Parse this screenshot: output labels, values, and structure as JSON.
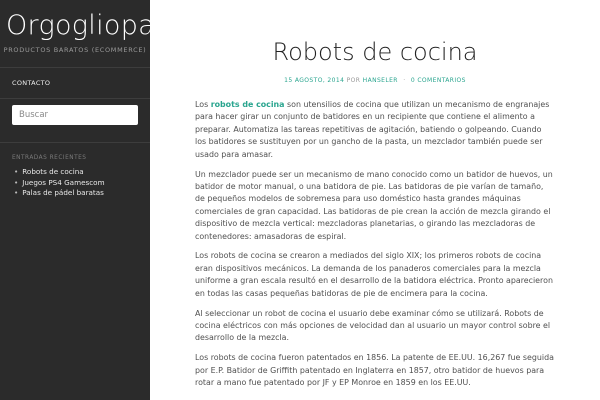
{
  "site": {
    "title": "Orgogliopa",
    "description": "PRODUCTOS BARATOS (ECOMMERCE)"
  },
  "menu": {
    "items": [
      {
        "label": "CONTACTO"
      }
    ]
  },
  "search": {
    "placeholder": "Buscar"
  },
  "recent_posts": {
    "title": "ENTRADAS RECIENTES",
    "items": [
      {
        "label": "Robots de cocina"
      },
      {
        "label": "Juegos PS4 Gamescom"
      },
      {
        "label": "Palas de pádel baratas"
      }
    ]
  },
  "post": {
    "title": "Robots de cocina",
    "meta": {
      "date": "15 AGOSTO, 2014",
      "by": "POR",
      "author": "HANSELER",
      "separator": "·",
      "comments": "0 COMENTARIOS"
    },
    "p1": {
      "before": "Los ",
      "highlight": "robots de cocina",
      "after": " son utensilios de cocina que utilizan un mecanismo de engranajes para hacer girar un conjunto de batidores en un recipiente que contiene el alimento a preparar. Automatiza las tareas repetitivas de agitación, batiendo o golpeando. Cuando los batidores se sustituyen por un gancho de la pasta, un mezclador también puede ser usado para amasar."
    },
    "p2": "Un mezclador puede ser un mecanismo de mano conocido como un batidor de huevos, un batidor de motor manual, o una batidora de pie. Las batidoras de pie varían de tamaño, de pequeños modelos de sobremesa para uso doméstico hasta grandes máquinas comerciales de gran capacidad. Las batidoras de pie crean la acción de mezcla girando el dispositivo de mezcla vertical: mezcladoras planetarias, o girando las mezcladoras de contenedores: amasadoras de espiral.",
    "p3": "Los robots de cocina se crearon a mediados del siglo XIX; los primeros robots de cocina eran dispositivos mecánicos. La demanda de los panaderos comerciales para la mezcla uniforme a gran escala resultó en el desarrollo de la batidora eléctrica. Pronto aparecieron en todas las casas pequeñas batidoras de pie de encimera para la cocina.",
    "p4": "Al seleccionar un robot de cocina el usuario debe examinar cómo se utilizará. Robots de cocina eléctricos con más opciones de velocidad dan al usuario un mayor control sobre el desarrollo de la mezcla.",
    "p5": "Los robots de cocina fueron patentados en 1856. La patente de EE.UU. 16,267  fue seguida por E.P. Batidor de Griffith patentado en Inglaterra en 1857, otro batidor de huevos para rotar a mano fue patentado por JF y EP Monroe en 1859 en los EE.UU."
  },
  "colors": {
    "accent": "#2aa58f",
    "sidebar_bg": "#2b2b2b"
  }
}
